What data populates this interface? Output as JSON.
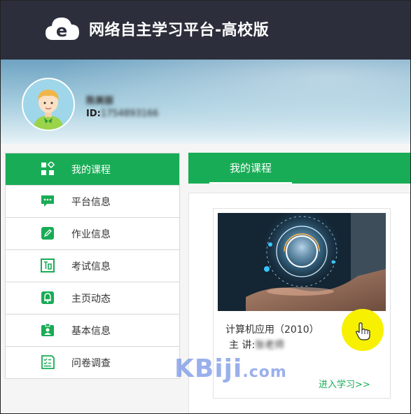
{
  "app": {
    "title": "网络自主学习平台-高校版",
    "logo_icon": "cloud-e-logo-icon"
  },
  "user": {
    "name": "陈美丽",
    "id_label": "ID:",
    "id_value": "1754893166",
    "avatar_icon": "boy-avatar-icon"
  },
  "sidebar": {
    "items": [
      {
        "label": "我的课程",
        "icon": "grid-icon",
        "active": true
      },
      {
        "label": "平台信息",
        "icon": "chat-bubble-icon"
      },
      {
        "label": "作业信息",
        "icon": "edit-icon"
      },
      {
        "label": "考试信息",
        "icon": "exam-icon"
      },
      {
        "label": "主页动态",
        "icon": "bell-icon"
      },
      {
        "label": "基本信息",
        "icon": "id-badge-icon"
      },
      {
        "label": "问卷调查",
        "icon": "checklist-icon"
      }
    ]
  },
  "main": {
    "tab_label": "我的课程",
    "course": {
      "title": "计算机应用（2010）",
      "teacher_label": "主 讲:",
      "teacher_value": "张老师",
      "enter_label": "进入学习>>"
    }
  },
  "watermark": {
    "text_main": "KBiji",
    "text_suffix": ".com"
  },
  "colors": {
    "accent": "#19ac56",
    "topbar": "#2c2f3b"
  }
}
